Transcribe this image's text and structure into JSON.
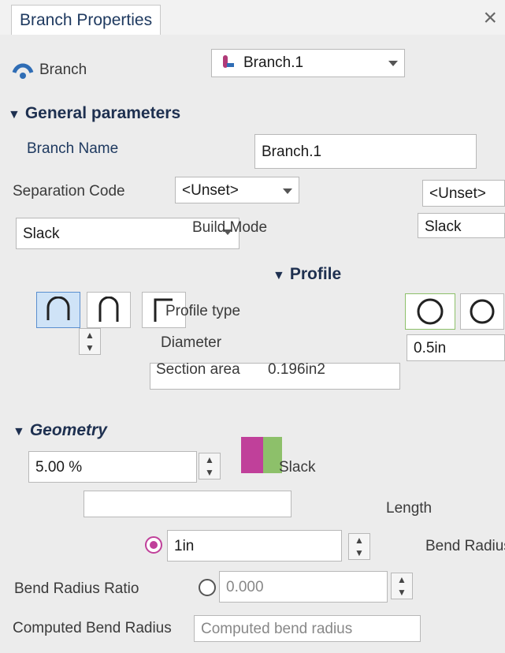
{
  "window": {
    "title": "Branch Properties",
    "close_glyph": "×"
  },
  "branch_row": {
    "label": "Branch",
    "selected": "Branch.1",
    "icon": "branch-icon"
  },
  "general": {
    "header": "General parameters",
    "name_label": "Branch Name",
    "name_value": "Branch.1",
    "separation_label": "Separation Code",
    "separation_value": "<Unset>",
    "separation_value_short": "<Unset>",
    "build_mode_label": "Build Mode",
    "build_mode_value": "Slack",
    "build_mode_short": "Slack"
  },
  "profile": {
    "header": "Profile",
    "type_label": "Profile type",
    "diameter_label": "Diameter",
    "diameter_value": "0.5in",
    "section_label": "Section area",
    "section_value": "0.196in2"
  },
  "geometry": {
    "header": "Geometry",
    "slack_label": "Slack",
    "slack_value": "5.00 %",
    "length_label": "Length",
    "bend_radius_label": "Bend Radius",
    "bend_radius_value": "1in",
    "bend_radius_ratio_label": "Bend Radius Ratio",
    "bend_radius_ratio_value": "0.000",
    "computed_label": "Computed Bend Radius",
    "computed_value": "Computed bend radius"
  },
  "colors": {
    "accent": "#5a8fcf",
    "header_text": "#1e3050",
    "magenta": "#c0409a",
    "green": "#8dc06a"
  }
}
